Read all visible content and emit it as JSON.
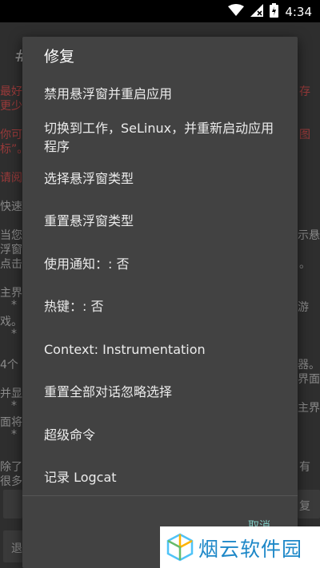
{
  "status_bar": {
    "time": "4:34"
  },
  "background": {
    "title_char": "#",
    "lines": [
      {
        "text": "最好",
        "red": true
      },
      {
        "text": "更少",
        "red": true
      },
      {
        "text": "存",
        "red": true
      },
      {
        "text": "你可",
        "red": true
      },
      {
        "text": "标”。",
        "red": true
      },
      {
        "text": "图",
        "red": true
      },
      {
        "text": "请阅",
        "red": true
      },
      {
        "text": "快速",
        "red": false
      },
      {
        "text": "当您",
        "red": false
      },
      {
        "text": "浮窗",
        "red": false
      },
      {
        "text": "点击",
        "red": false
      },
      {
        "text": "示悬",
        "red": false
      },
      {
        "text": "。",
        "red": false
      },
      {
        "text": "主界",
        "red": false
      },
      {
        "text": "*",
        "red": false
      },
      {
        "text": "戏。",
        "red": false
      },
      {
        "text": "游",
        "red": false
      },
      {
        "text": "*",
        "red": false
      },
      {
        "text": "4个",
        "red": false
      },
      {
        "text": "器。",
        "red": false
      },
      {
        "text": "并显",
        "red": false
      },
      {
        "text": "界面",
        "red": false
      },
      {
        "text": "*",
        "red": false
      },
      {
        "text": "主界",
        "red": false
      },
      {
        "text": "面将",
        "red": false
      },
      {
        "text": "*",
        "red": false
      },
      {
        "text": "除了",
        "red": false
      },
      {
        "text": "有",
        "red": false
      },
      {
        "text": "很多",
        "red": false
      },
      {
        "text": "复",
        "red": false
      },
      {
        "text": "退",
        "red": false
      }
    ]
  },
  "dialog": {
    "title": "修复",
    "items": [
      "禁用悬浮窗并重启应用",
      "切换到工作，SeLinux，并重新启动应用程序",
      "选择悬浮窗类型",
      "重置悬浮窗类型",
      "使用通知：: 否",
      "热键：: 否",
      "Context: Instrumentation",
      "重置全部对话忽略选择",
      "超级命令",
      "记录 Logcat"
    ],
    "cancel": "取消"
  },
  "watermark": {
    "text": "烟云软件园"
  },
  "colors": {
    "dialog_bg": "#424242",
    "accent": "#80cbc4",
    "watermark_blue": "#1e88c8"
  }
}
